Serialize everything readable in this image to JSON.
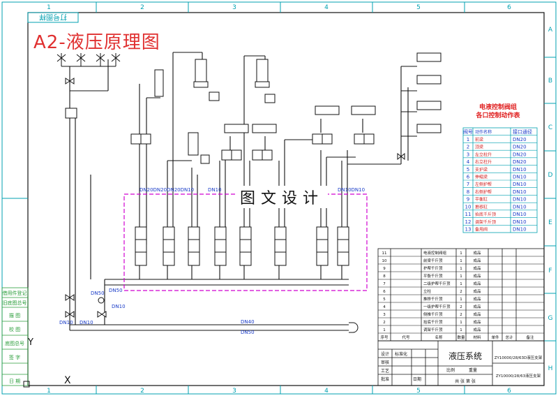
{
  "drawing": {
    "title": "A2-液压原理图",
    "stamp": "图文设计",
    "frame_top_label": "打号图样",
    "column_numbers": [
      "1",
      "2",
      "3",
      "4",
      "5",
      "6"
    ],
    "row_letters": [
      "A",
      "B",
      "C",
      "D",
      "E",
      "F",
      "G",
      "H"
    ],
    "main_lines": [
      "DN40",
      "DN50"
    ],
    "pipe_labels": {
      "top_row": "DN20DN20DN20DN10",
      "top_row_right": "DN10DN10",
      "top_row_end": "DN10",
      "left_a": "DN50",
      "left_b": "DN50",
      "left_c": "DN10",
      "left_d": "DN10",
      "left_e": "DN10"
    },
    "corner_marks": {
      "y_mark": "Y",
      "x_mark": "X"
    }
  },
  "legend": {
    "title_line1": "电液控制阀组",
    "title_line2": "各口控制动作表",
    "header": [
      "阀号",
      "动作名称",
      "接口通径"
    ],
    "rows": [
      [
        "1",
        "前梁",
        "DN20"
      ],
      [
        "2",
        "顶梁",
        "DN20"
      ],
      [
        "3",
        "左立柱升",
        "DN20"
      ],
      [
        "4",
        "右立柱升",
        "DN20"
      ],
      [
        "5",
        "支护梁",
        "DN10"
      ],
      [
        "6",
        "伸缩梁",
        "DN10"
      ],
      [
        "7",
        "左侧护帮",
        "DN10"
      ],
      [
        "8",
        "右侧护帮",
        "DN10"
      ],
      [
        "9",
        "平衡缸",
        "DN10"
      ],
      [
        "10",
        "推移缸",
        "DN10"
      ],
      [
        "11",
        "抬底千斤顶",
        "DN10"
      ],
      [
        "12",
        "调架千斤顶",
        "DN10"
      ],
      [
        "13",
        "备用阀",
        "DN10"
      ]
    ]
  },
  "parts_list": {
    "rows": [
      [
        "11",
        "电液控制阀组",
        "1",
        "成品"
      ],
      [
        "10",
        "前梁千斤顶",
        "1",
        "成品"
      ],
      [
        "9",
        "护帮千斤顶",
        "1",
        "成品"
      ],
      [
        "8",
        "平衡千斤顶",
        "1",
        "成品"
      ],
      [
        "7",
        "二级护帮千斤顶",
        "1",
        "成品"
      ],
      [
        "6",
        "立柱",
        "2",
        "成品"
      ],
      [
        "5",
        "推移千斤顶",
        "1",
        "成品"
      ],
      [
        "4",
        "一级护帮千斤顶",
        "2",
        "成品"
      ],
      [
        "3",
        "侧推千斤顶",
        "2",
        "成品"
      ],
      [
        "2",
        "抬底千斤顶",
        "1",
        "成品"
      ],
      [
        "1",
        "调架千斤顶",
        "1",
        "成品"
      ]
    ],
    "header": [
      "序号",
      "代号",
      "名称",
      "数量",
      "材料",
      "单件",
      "总计",
      "备注"
    ]
  },
  "title_block": {
    "name": "液压系统",
    "code_1": "ZY10000/28/63D液压支架",
    "code_2": "ZY10000/28/63液压支架",
    "sheet_note": "共 张 第 张",
    "scale_label": "比例",
    "weight_label": "重量",
    "labels": [
      "设计",
      "审核",
      "工艺",
      "标准化",
      "批准",
      "日期"
    ]
  },
  "left_strip": [
    "借用件登记",
    "旧底图总号",
    "描 图",
    "校 图",
    "底图总号",
    "签 字",
    "日 期"
  ]
}
